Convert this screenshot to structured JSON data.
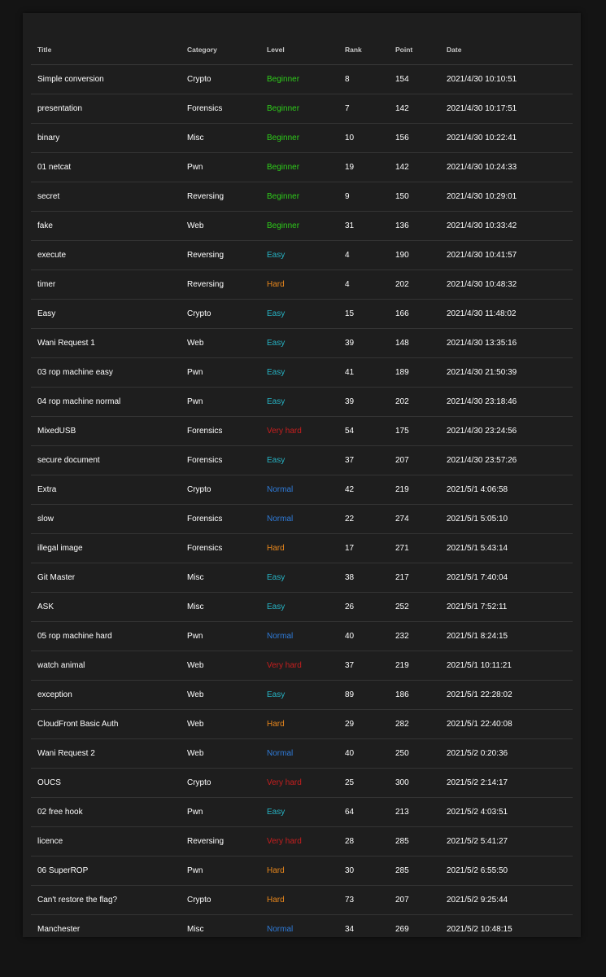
{
  "table": {
    "headers": {
      "title": "Title",
      "category": "Category",
      "level": "Level",
      "rank": "Rank",
      "point": "Point",
      "date": "Date"
    },
    "level_colors": {
      "Beginner": "#2ecc1a",
      "Easy": "#27b3c4",
      "Normal": "#2f7bd8",
      "Hard": "#e8871c",
      "Very hard": "#c81e1e"
    },
    "rows": [
      {
        "title": "Simple conversion",
        "category": "Crypto",
        "level": "Beginner",
        "rank": "8",
        "point": "154",
        "date": "2021/4/30 10:10:51"
      },
      {
        "title": "presentation",
        "category": "Forensics",
        "level": "Beginner",
        "rank": "7",
        "point": "142",
        "date": "2021/4/30 10:17:51"
      },
      {
        "title": "binary",
        "category": "Misc",
        "level": "Beginner",
        "rank": "10",
        "point": "156",
        "date": "2021/4/30 10:22:41"
      },
      {
        "title": "01 netcat",
        "category": "Pwn",
        "level": "Beginner",
        "rank": "19",
        "point": "142",
        "date": "2021/4/30 10:24:33"
      },
      {
        "title": "secret",
        "category": "Reversing",
        "level": "Beginner",
        "rank": "9",
        "point": "150",
        "date": "2021/4/30 10:29:01"
      },
      {
        "title": "fake",
        "category": "Web",
        "level": "Beginner",
        "rank": "31",
        "point": "136",
        "date": "2021/4/30 10:33:42"
      },
      {
        "title": "execute",
        "category": "Reversing",
        "level": "Easy",
        "rank": "4",
        "point": "190",
        "date": "2021/4/30 10:41:57"
      },
      {
        "title": "timer",
        "category": "Reversing",
        "level": "Hard",
        "rank": "4",
        "point": "202",
        "date": "2021/4/30 10:48:32"
      },
      {
        "title": "Easy",
        "category": "Crypto",
        "level": "Easy",
        "rank": "15",
        "point": "166",
        "date": "2021/4/30 11:48:02"
      },
      {
        "title": "Wani Request 1",
        "category": "Web",
        "level": "Easy",
        "rank": "39",
        "point": "148",
        "date": "2021/4/30 13:35:16"
      },
      {
        "title": "03 rop machine easy",
        "category": "Pwn",
        "level": "Easy",
        "rank": "41",
        "point": "189",
        "date": "2021/4/30 21:50:39"
      },
      {
        "title": "04 rop machine normal",
        "category": "Pwn",
        "level": "Easy",
        "rank": "39",
        "point": "202",
        "date": "2021/4/30 23:18:46"
      },
      {
        "title": "MixedUSB",
        "category": "Forensics",
        "level": "Very hard",
        "rank": "54",
        "point": "175",
        "date": "2021/4/30 23:24:56"
      },
      {
        "title": "secure document",
        "category": "Forensics",
        "level": "Easy",
        "rank": "37",
        "point": "207",
        "date": "2021/4/30 23:57:26"
      },
      {
        "title": "Extra",
        "category": "Crypto",
        "level": "Normal",
        "rank": "42",
        "point": "219",
        "date": "2021/5/1 4:06:58"
      },
      {
        "title": "slow",
        "category": "Forensics",
        "level": "Normal",
        "rank": "22",
        "point": "274",
        "date": "2021/5/1 5:05:10"
      },
      {
        "title": "illegal image",
        "category": "Forensics",
        "level": "Hard",
        "rank": "17",
        "point": "271",
        "date": "2021/5/1 5:43:14"
      },
      {
        "title": "Git Master",
        "category": "Misc",
        "level": "Easy",
        "rank": "38",
        "point": "217",
        "date": "2021/5/1 7:40:04"
      },
      {
        "title": "ASK",
        "category": "Misc",
        "level": "Easy",
        "rank": "26",
        "point": "252",
        "date": "2021/5/1 7:52:11"
      },
      {
        "title": "05 rop machine hard",
        "category": "Pwn",
        "level": "Normal",
        "rank": "40",
        "point": "232",
        "date": "2021/5/1 8:24:15"
      },
      {
        "title": "watch animal",
        "category": "Web",
        "level": "Very hard",
        "rank": "37",
        "point": "219",
        "date": "2021/5/1 10:11:21"
      },
      {
        "title": "exception",
        "category": "Web",
        "level": "Easy",
        "rank": "89",
        "point": "186",
        "date": "2021/5/1 22:28:02"
      },
      {
        "title": "CloudFront Basic Auth",
        "category": "Web",
        "level": "Hard",
        "rank": "29",
        "point": "282",
        "date": "2021/5/1 22:40:08"
      },
      {
        "title": "Wani Request 2",
        "category": "Web",
        "level": "Normal",
        "rank": "40",
        "point": "250",
        "date": "2021/5/2 0:20:36"
      },
      {
        "title": "OUCS",
        "category": "Crypto",
        "level": "Very hard",
        "rank": "25",
        "point": "300",
        "date": "2021/5/2 2:14:17"
      },
      {
        "title": "02 free hook",
        "category": "Pwn",
        "level": "Easy",
        "rank": "64",
        "point": "213",
        "date": "2021/5/2 4:03:51"
      },
      {
        "title": "licence",
        "category": "Reversing",
        "level": "Very hard",
        "rank": "28",
        "point": "285",
        "date": "2021/5/2 5:41:27"
      },
      {
        "title": "06 SuperROP",
        "category": "Pwn",
        "level": "Hard",
        "rank": "30",
        "point": "285",
        "date": "2021/5/2 6:55:50"
      },
      {
        "title": "Can't restore the flag?",
        "category": "Crypto",
        "level": "Hard",
        "rank": "73",
        "point": "207",
        "date": "2021/5/2 9:25:44"
      },
      {
        "title": "Manchester",
        "category": "Misc",
        "level": "Normal",
        "rank": "34",
        "point": "269",
        "date": "2021/5/2 10:48:15"
      }
    ]
  }
}
